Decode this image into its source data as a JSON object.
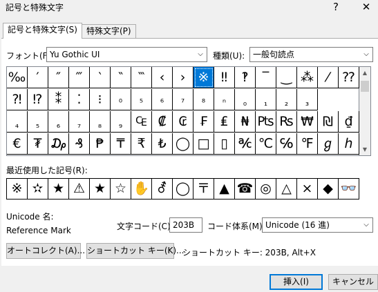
{
  "window": {
    "title": "記号と特殊文字",
    "help_label": "?",
    "close_label": "✕"
  },
  "tabs": [
    {
      "label": "記号と特殊文字(S)"
    },
    {
      "label": "特殊文字(P)"
    }
  ],
  "font": {
    "label": "フォント(F):",
    "value": "Yu Gothic UI"
  },
  "subset": {
    "label": "種類(U):",
    "value": "一般句読点"
  },
  "symbols": [
    [
      "‰",
      "′",
      "″",
      "‴",
      "‵",
      "‶",
      "‷",
      "‹",
      "›",
      "※",
      "‼",
      "‽",
      "‾",
      "‿",
      "⁂",
      "⁄",
      "⁇"
    ],
    [
      "⁈",
      "⁉",
      "⁑",
      "⁚",
      "⁝",
      "⁰",
      "⁵",
      "⁶",
      "⁷",
      "⁸",
      "ⁿ",
      "₀",
      "₁",
      "₂",
      "₃"
    ],
    [
      "₄",
      "₅",
      "₆",
      "₇",
      "₈",
      "₉",
      "₠",
      "₡",
      "₢",
      "₣",
      "₤",
      "₦",
      "₧",
      "₨",
      "₩",
      "₪",
      "₫"
    ],
    [
      "€",
      "₮",
      "₯",
      "₰",
      "₱",
      "₸",
      "₹",
      "₺",
      "◯",
      "□",
      "▯",
      "℀",
      "℃",
      "℅",
      "℉",
      "ℊ",
      "ℎ"
    ]
  ],
  "selected_symbol": "※",
  "recent": {
    "label": "最近使用した記号(R):",
    "items": [
      "※",
      "✫",
      "★",
      "⚠",
      "★",
      "☆",
      "✋",
      "⚦",
      "◯",
      "〒",
      "▲",
      "☎",
      "◎",
      "△",
      "×",
      "◆",
      "👓"
    ]
  },
  "unicode": {
    "name_label": "Unicode 名:",
    "char_name": "Reference Mark"
  },
  "char_code": {
    "label": "文字コード(C):",
    "value": "203B"
  },
  "encoding": {
    "label": "コード体系(M):",
    "value": "Unicode (16 進)"
  },
  "buttons": {
    "autocorrect": "オートコレクト(A)...",
    "shortcut_key": "ショートカット キー(K)...",
    "insert": "挿入(I)",
    "cancel": "キャンセル"
  },
  "shortcut_text": "ショートカット キー: 203B, Alt+X"
}
